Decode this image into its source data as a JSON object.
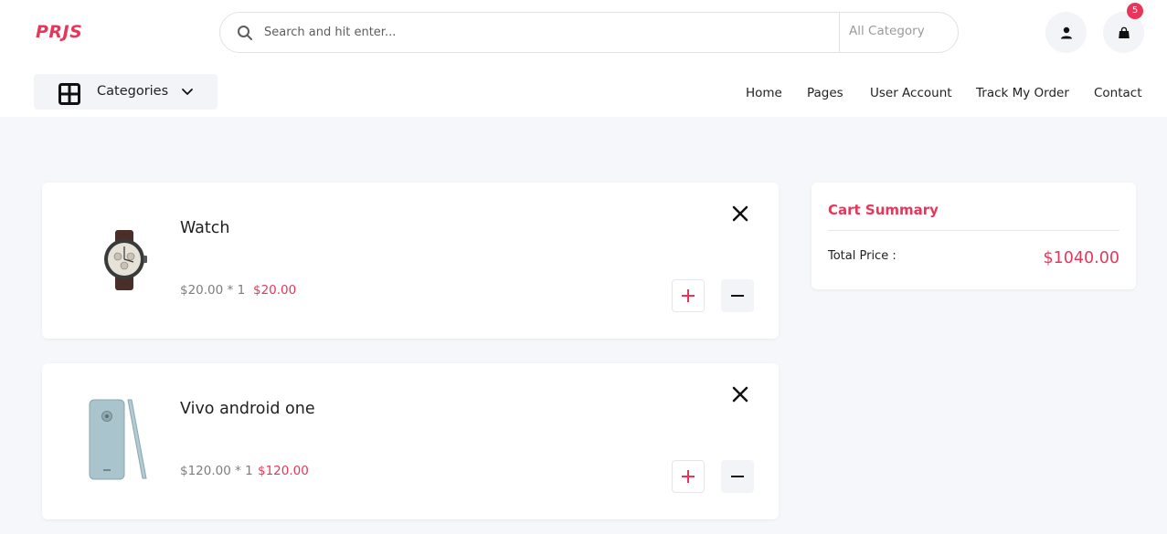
{
  "brand": {
    "logo_text": "PRJS",
    "accent_color": "#e8365a"
  },
  "search": {
    "placeholder": "Search and hit enter...",
    "value": "",
    "category_label": "All Category"
  },
  "header": {
    "cart_count": "5",
    "user_icon": "user-icon",
    "cart_icon": "shopping-bag-icon"
  },
  "categories": {
    "label": "Categories"
  },
  "nav": {
    "items": [
      "Home",
      "Pages",
      "User Account",
      "Track My Order",
      "Contact"
    ]
  },
  "cart": {
    "items": [
      {
        "name": "Watch",
        "unit_price": "$20.00 * 1",
        "line_total": "$20.00",
        "image": "watch-image"
      },
      {
        "name": "Vivo android one",
        "unit_price": "$120.00 * 1",
        "line_total": "$120.00",
        "image": "phone-image"
      }
    ]
  },
  "summary": {
    "title": "Cart Summary",
    "total_label": "Total Price :",
    "total_value": "$1040.00"
  }
}
